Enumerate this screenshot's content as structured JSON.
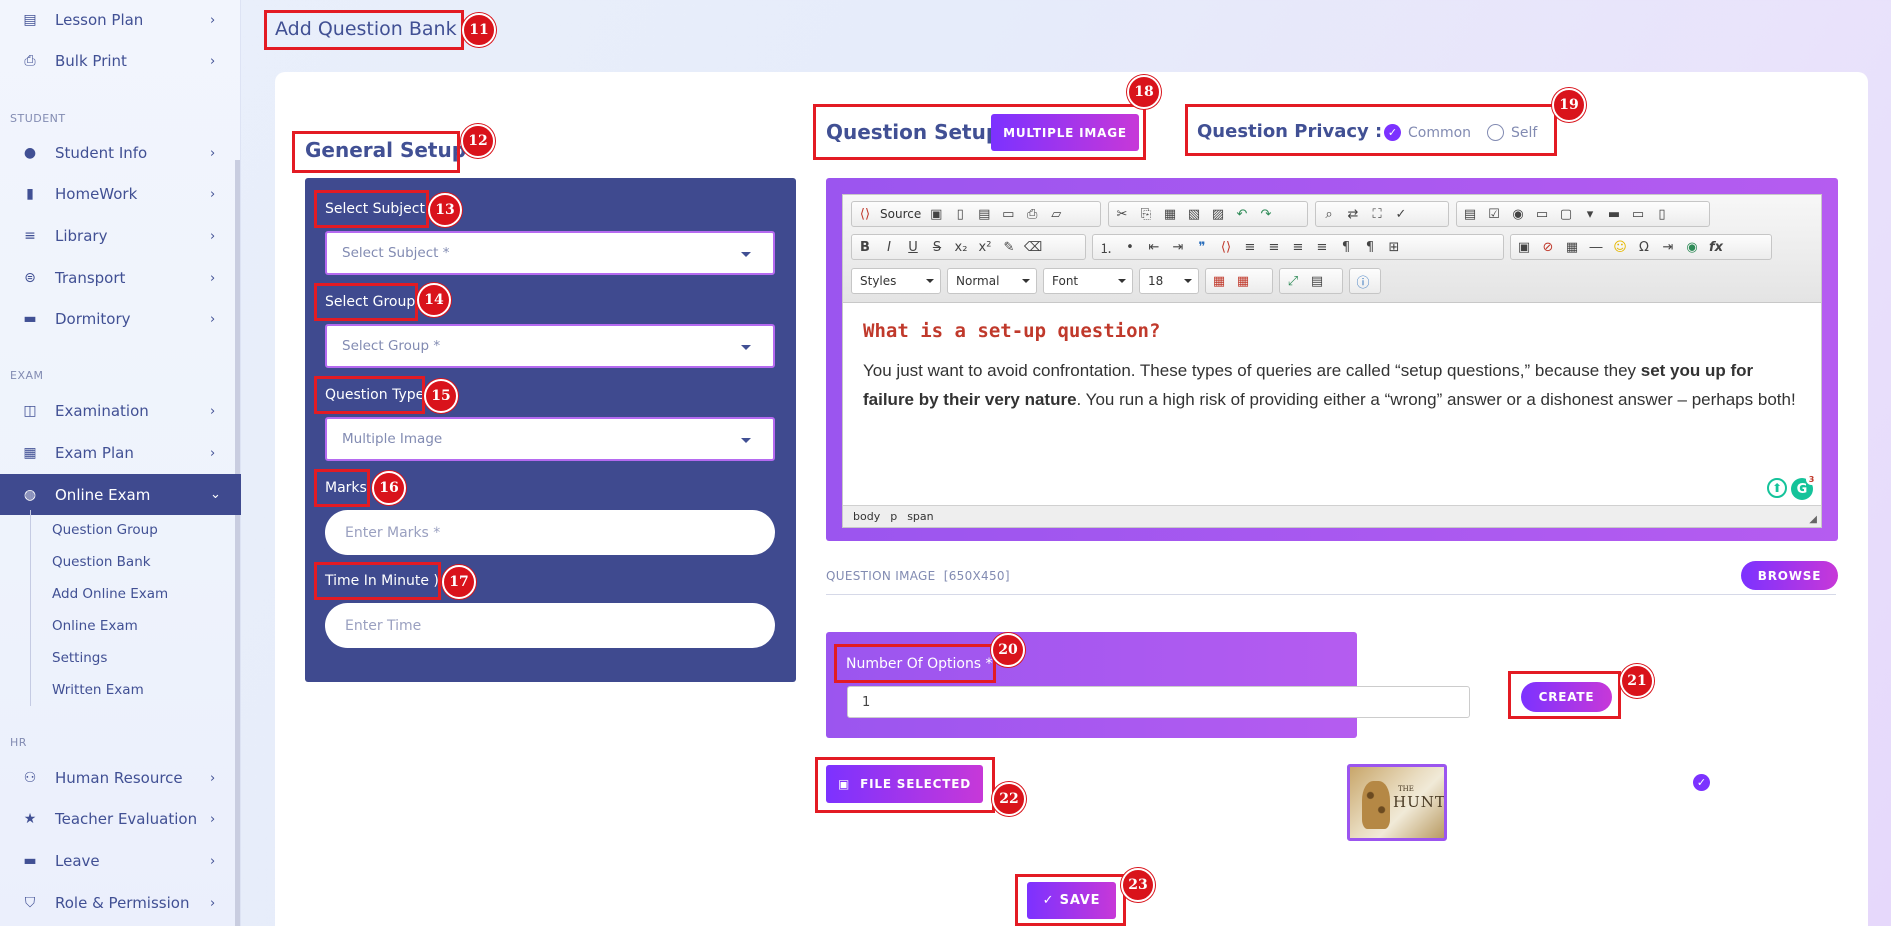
{
  "sidebar": {
    "sections": {
      "student": "STUDENT",
      "exam": "EXAM",
      "hr": "HR"
    },
    "items_top": [
      {
        "label": "Lesson Plan",
        "icon": "book-icon"
      },
      {
        "label": "Bulk Print",
        "icon": "printer-icon"
      }
    ],
    "items_student": [
      {
        "label": "Student Info",
        "icon": "user-icon"
      },
      {
        "label": "HomeWork",
        "icon": "book-open-icon"
      },
      {
        "label": "Library",
        "icon": "library-icon"
      },
      {
        "label": "Transport",
        "icon": "bus-icon"
      },
      {
        "label": "Dormitory",
        "icon": "bed-icon"
      }
    ],
    "items_exam": [
      {
        "label": "Examination",
        "icon": "map-icon"
      },
      {
        "label": "Exam Plan",
        "icon": "clipboard-icon"
      },
      {
        "label": "Online Exam",
        "icon": "globe-icon"
      }
    ],
    "online_exam_sub": [
      "Question Group",
      "Question Bank",
      "Add Online Exam",
      "Online Exam",
      "Settings",
      "Written Exam"
    ],
    "items_hr": [
      {
        "label": "Human Resource",
        "icon": "users-icon"
      },
      {
        "label": "Teacher Evaluation",
        "icon": "star-icon"
      },
      {
        "label": "Leave",
        "icon": "bed-icon"
      },
      {
        "label": "Role & Permission",
        "icon": "shield-icon"
      }
    ]
  },
  "page_title": "Add Question Bank",
  "general_setup": {
    "title": "General Setup",
    "subject_label": "Select Subject",
    "subject_placeholder": "Select Subject *",
    "group_label": "Select Group",
    "group_placeholder": "Select Group *",
    "type_label": "Question Type",
    "type_value": "Multiple Image",
    "marks_label": "Marks",
    "marks_placeholder": "Enter Marks *",
    "time_label": "Time In Minute )",
    "time_placeholder": "Enter Time"
  },
  "question_setup": {
    "title": "Question Setup",
    "type_button": "MULTIPLE IMAGE"
  },
  "privacy": {
    "title": "Question Privacy :",
    "common": "Common",
    "self": "Self"
  },
  "editor": {
    "source_label": "Source",
    "styles": "Styles",
    "format": "Normal",
    "font": "Font",
    "size": "18",
    "heading": "What is a set-up question?",
    "para_1": "You just want to avoid confrontation. These types of queries are called “setup questions,” because they ",
    "para_bold": "set you up for failure by their very nature",
    "para_2": ". You run a high risk of providing either a “wrong” answer or a dishonest answer – perhaps both!",
    "status_path": [
      "body",
      "p",
      "span"
    ],
    "grammarly_count": "3"
  },
  "image_section": {
    "label": "QUESTION IMAGE",
    "size": "[650X450]",
    "browse": "BROWSE"
  },
  "options": {
    "label": "Number Of Options *",
    "value": "1",
    "create": "CREATE"
  },
  "file_button": "FILE SELECTED",
  "thumbnail_text": "HUNT",
  "thumbnail_small": "THE",
  "save_button": "✓ SAVE",
  "annotations": [
    "11",
    "12",
    "13",
    "14",
    "15",
    "16",
    "17",
    "18",
    "19",
    "20",
    "21",
    "22",
    "23"
  ],
  "colors": {
    "primary": "#415094",
    "purple": "#7c32ff",
    "annotation": "#e31b23"
  }
}
